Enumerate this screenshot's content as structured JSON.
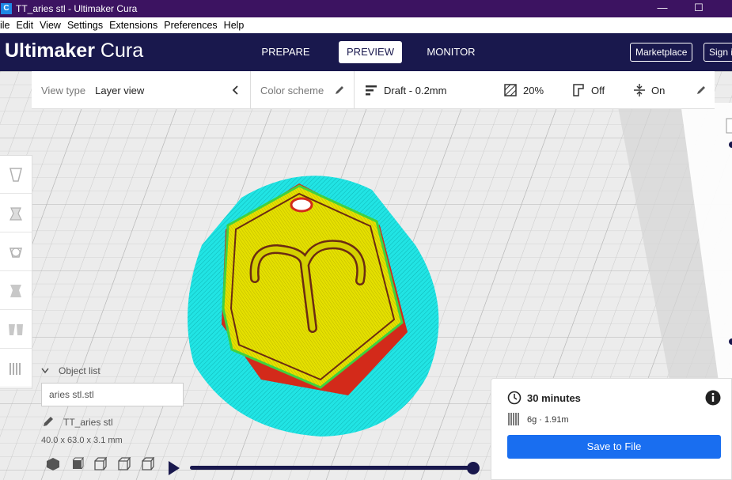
{
  "window": {
    "title": "TT_aries stl - Ultimaker Cura",
    "app_icon_letter": "C",
    "minimize_glyph": "—",
    "maximize_glyph": "☐"
  },
  "menu": {
    "items": [
      "ile",
      "Edit",
      "View",
      "Settings",
      "Extensions",
      "Preferences",
      "Help"
    ]
  },
  "header": {
    "logo_brand": "Ultimaker",
    "logo_product": "Cura",
    "tabs": [
      "PREPARE",
      "PREVIEW",
      "MONITOR"
    ],
    "active_tab": "PREVIEW",
    "marketplace_label": "Marketplace",
    "signin_label": "Sign in"
  },
  "view_bar": {
    "view_type_label": "View type",
    "view_type_value": "Layer view",
    "color_scheme_label": "Color scheme",
    "profile": "Draft - 0.2mm",
    "infill": "20%",
    "support": "Off",
    "adhesion": "On"
  },
  "object_list": {
    "header": "Object list",
    "file_value": "aries stl.stl",
    "object_name": "TT_aries stl",
    "dimensions": "40.0 x 63.0 x 3.1 mm"
  },
  "action_panel": {
    "print_time": "30 minutes",
    "material_usage": "6g · 1.91m",
    "save_label": "Save to File"
  },
  "layer_slider": {
    "position": 1.0
  },
  "colors": {
    "titlebar": "#3c1361",
    "header": "#19184d",
    "accent": "#196ef0",
    "wall_outer": "#e8371f",
    "wall_inner": "#3fd23f",
    "infill": "#e5e000",
    "skirt": "#21e4e4"
  },
  "icons": [
    "app-icon",
    "minimize-icon",
    "maximize-icon",
    "chevron-left-icon",
    "pencil-icon",
    "profile-icon",
    "infill-icon",
    "support-icon",
    "adhesion-icon",
    "chevron-down-icon",
    "clock-icon",
    "info-icon",
    "spool-icon",
    "play-icon"
  ]
}
